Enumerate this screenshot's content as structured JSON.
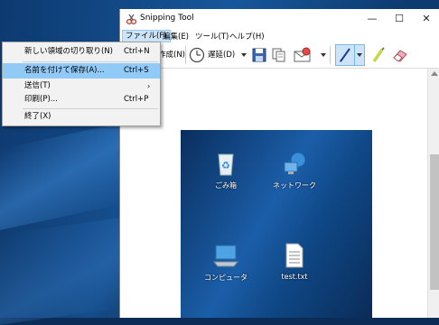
{
  "window": {
    "title": "Snipping Tool",
    "minimize_glyph": "—",
    "maximize_glyph": "☐",
    "close_glyph": "✕"
  },
  "menubar": {
    "items": [
      {
        "label": "ファイル(F)",
        "active": true
      },
      {
        "label": "編集(E)"
      },
      {
        "label": "ツール(T)"
      },
      {
        "label": "ヘルプ(H)"
      }
    ]
  },
  "toolbar": {
    "new_partial_label": "作成(N)",
    "delay_label": "遅延(D)"
  },
  "file_menu": {
    "items": [
      {
        "label": "新しい領域の切り取り(N)",
        "shortcut": "Ctrl+N"
      },
      {
        "label": "名前を付けて保存(A)...",
        "shortcut": "Ctrl+S",
        "highlighted": true
      },
      {
        "label": "送信(T)",
        "submenu_glyph": "›"
      },
      {
        "label": "印刷(P)...",
        "shortcut": "Ctrl+P"
      },
      {
        "label": "終了(X)"
      }
    ]
  },
  "snip": {
    "icons": [
      {
        "name": "recycle-bin-icon",
        "label": "ごみ箱"
      },
      {
        "name": "network-icon",
        "label": "ネットワーク"
      },
      {
        "name": "computer-icon",
        "label": "コンピュータ"
      },
      {
        "name": "text-file-icon",
        "label": "test.txt"
      }
    ]
  },
  "colors": {
    "highlight": "#91c9f7",
    "menu_active": "#cce4f7",
    "desktop": "#0b2f60"
  }
}
